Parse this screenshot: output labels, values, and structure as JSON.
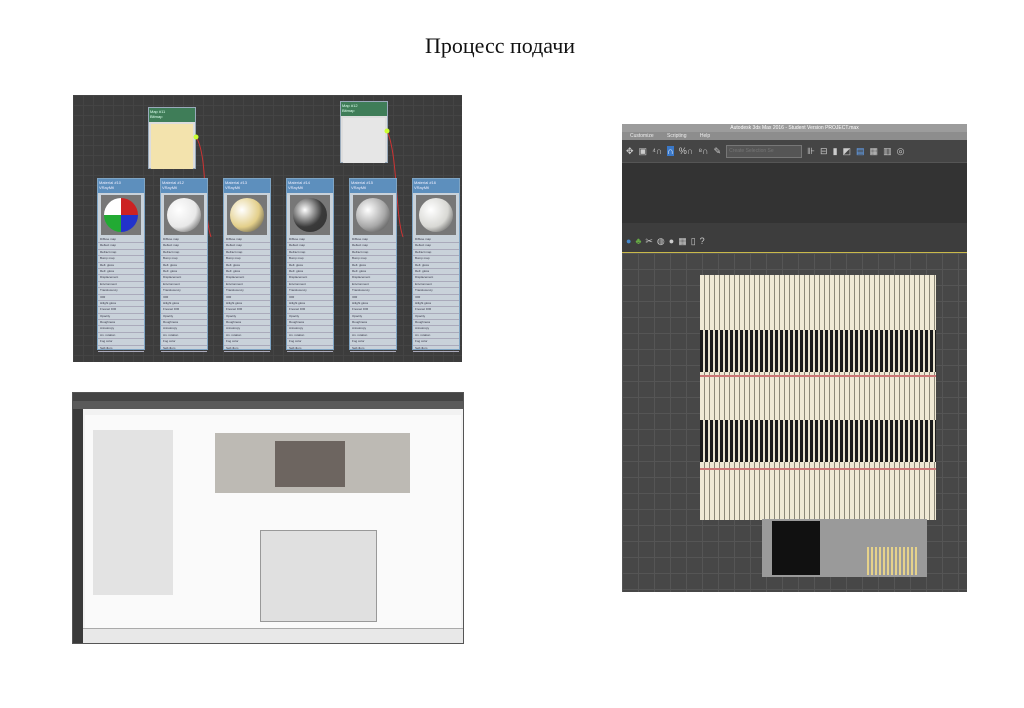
{
  "slide": {
    "title": "Процесс подачи"
  },
  "material_editor": {
    "map_nodes": [
      {
        "title": "Map #11",
        "type": "Bitmap",
        "color": "#f3e3ad"
      },
      {
        "title": "Map #12",
        "type": "Bitmap",
        "color": "#e6e6e6"
      }
    ],
    "material_nodes": [
      {
        "title": "Material #10",
        "type": "VRayMtl",
        "sphere": "checker"
      },
      {
        "title": "Material #12",
        "type": "VRayMtl",
        "sphere": "#e8e8e8"
      },
      {
        "title": "Material #13",
        "type": "VRayMtl",
        "sphere": "#e3cf8a"
      },
      {
        "title": "Material #14",
        "type": "VRayMtl",
        "sphere": "#3a3a3a"
      },
      {
        "title": "Material #15",
        "type": "VRayMtl",
        "sphere": "#a8a8a8"
      },
      {
        "title": "Material #16",
        "type": "VRayMtl",
        "sphere": "#d8d8d4"
      }
    ],
    "slots": [
      "Diffuse map",
      "Reflect map",
      "Refract map",
      "Bump map",
      "Refl. gloss",
      "Refr. gloss",
      "Displacement",
      "Environment",
      "Translucency",
      "IOR",
      "Hilight gloss",
      "Fresnel IOR",
      "Opacity",
      "Roughness",
      "Anisotropy",
      "An. rotation",
      "Fog color",
      "Self-illum"
    ]
  },
  "max": {
    "window_title": "Autodesk 3ds Max 2016 - Student Version   PROJECT.max",
    "menus": [
      "Customize",
      "Scripting",
      "Help"
    ],
    "selection_set_placeholder": "Create Selection Se"
  }
}
